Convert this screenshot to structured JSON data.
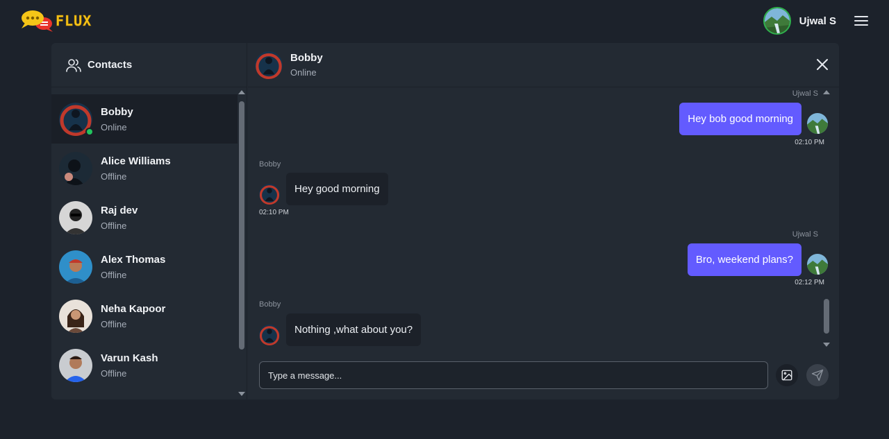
{
  "app": {
    "logo_text": "FLUX"
  },
  "user": {
    "name": "Ujwal S"
  },
  "sidebar": {
    "title": "Contacts",
    "contacts": [
      {
        "name": "Bobby",
        "status": "Online"
      },
      {
        "name": "Alice Williams",
        "status": "Offline"
      },
      {
        "name": "Raj dev",
        "status": "Offline"
      },
      {
        "name": "Alex Thomas",
        "status": "Offline"
      },
      {
        "name": "Neha Kapoor",
        "status": "Offline"
      },
      {
        "name": "Varun Kash",
        "status": "Offline"
      }
    ]
  },
  "chat": {
    "contact_name": "Bobby",
    "contact_status": "Online",
    "messages": [
      {
        "sender": "Ujwal S",
        "text": "Hey bob good morning",
        "time": "02:10 PM",
        "direction": "out"
      },
      {
        "sender": "Bobby",
        "text": "Hey good morning",
        "time": "02:10 PM",
        "direction": "in"
      },
      {
        "sender": "Ujwal S",
        "text": "Bro, weekend plans?",
        "time": "02:12 PM",
        "direction": "out"
      },
      {
        "sender": "Bobby",
        "text": "Nothing ,what about you?",
        "time": "",
        "direction": "in"
      }
    ],
    "composer_placeholder": "Type a message..."
  },
  "colors": {
    "outgoing_bubble": "#635bff",
    "online_dot": "#22c55e",
    "background": "#1c222b",
    "card": "#232a33"
  }
}
